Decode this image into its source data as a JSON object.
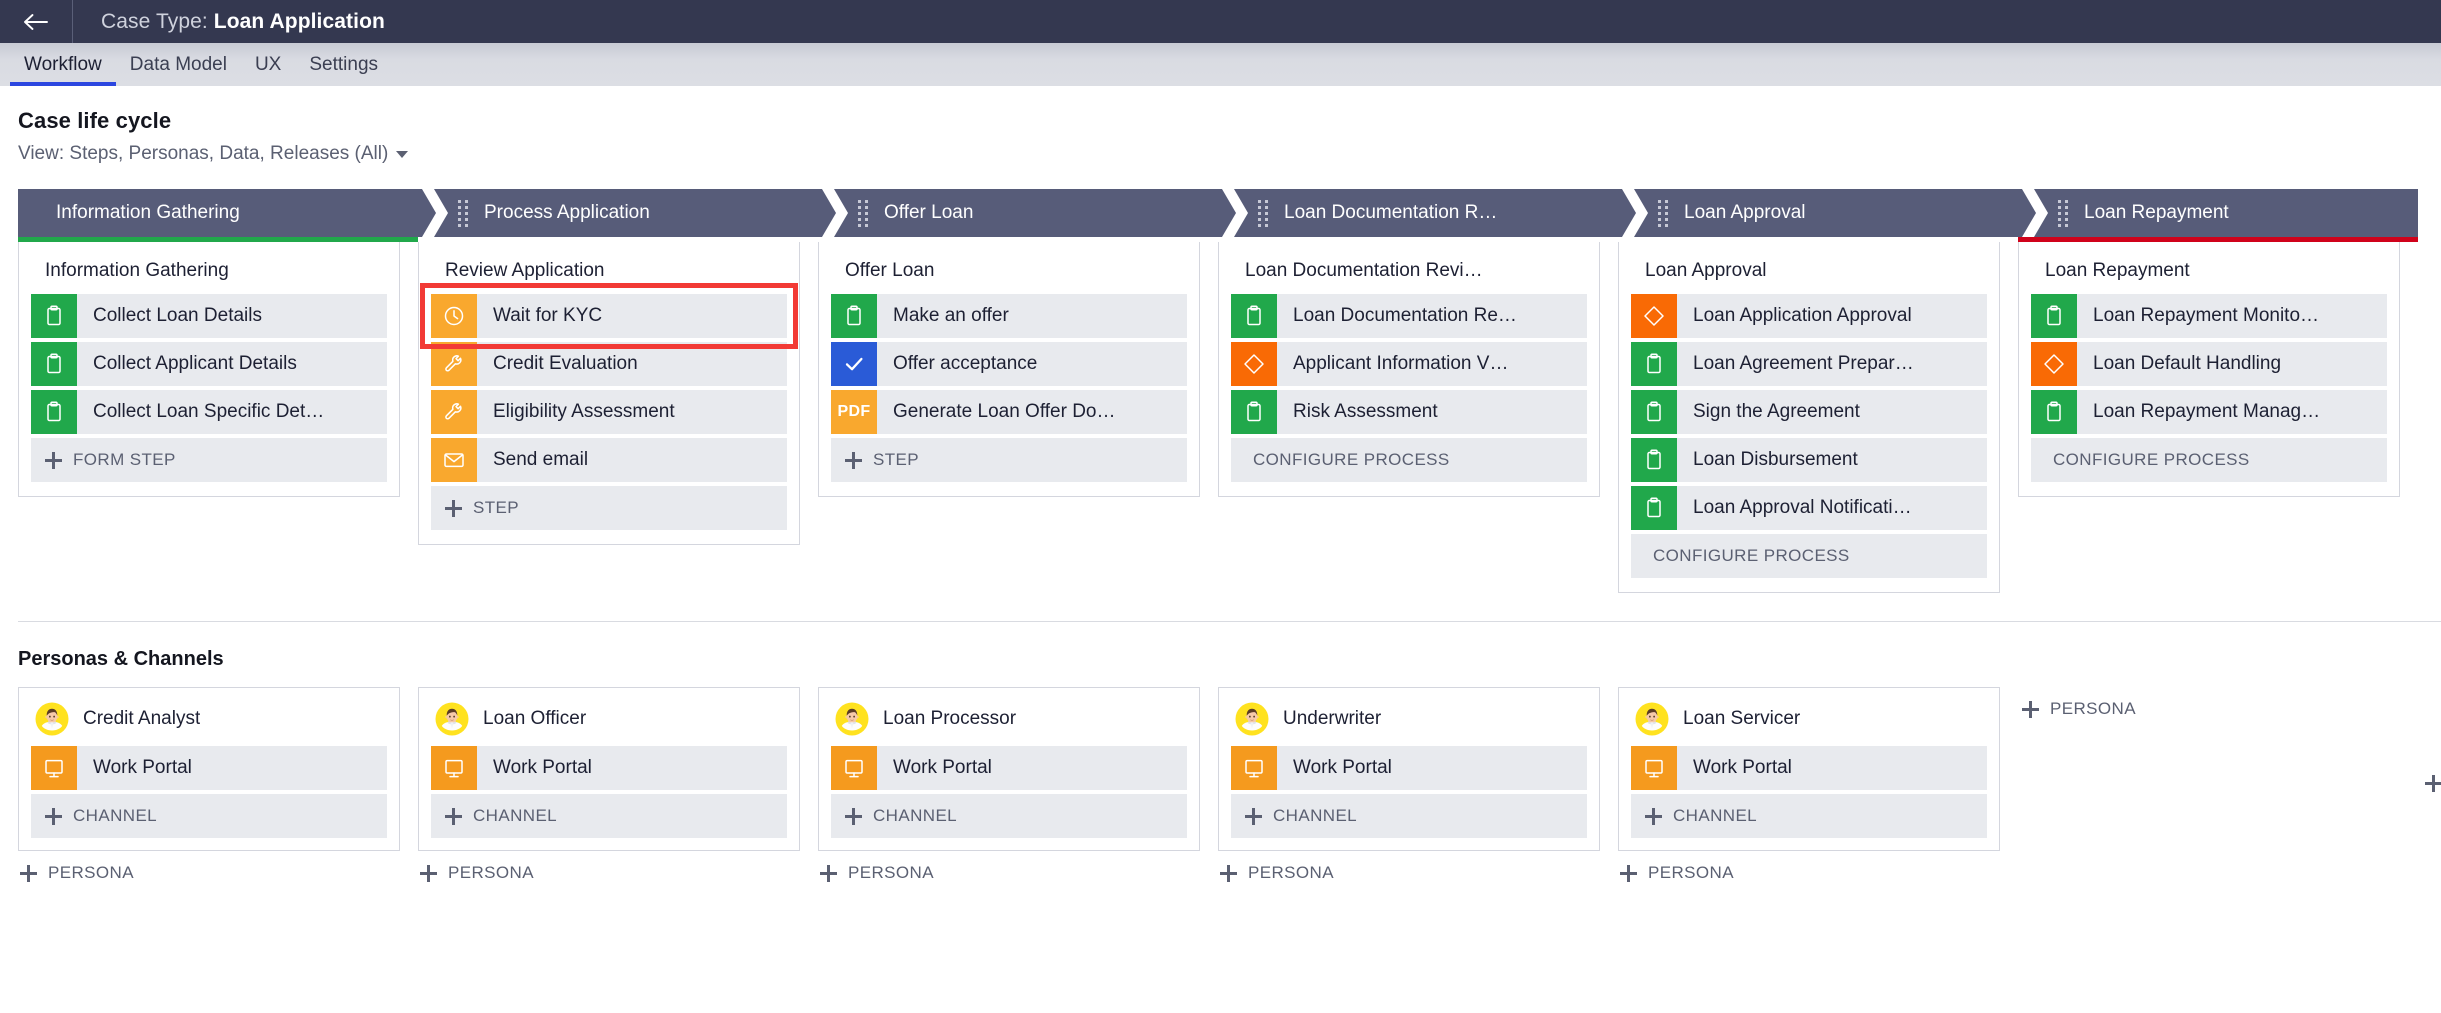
{
  "topbar": {
    "back_icon": "arrow-left-icon",
    "prefix": "Case Type: ",
    "case_type": "Loan Application"
  },
  "tabs": [
    {
      "label": "Workflow",
      "active": true
    },
    {
      "label": "Data Model",
      "active": false
    },
    {
      "label": "UX",
      "active": false
    },
    {
      "label": "Settings",
      "active": false
    }
  ],
  "lifecycle": {
    "title": "Case life cycle",
    "view_label": "View: Steps, Personas, Data, Releases (All)",
    "stages": [
      {
        "name": "Information Gathering",
        "accent": "green",
        "first": true,
        "process_title": "Information Gathering",
        "steps": [
          {
            "label": "Collect Loan Details",
            "icon": "clipboard-icon",
            "color": "green"
          },
          {
            "label": "Collect Applicant Details",
            "icon": "clipboard-icon",
            "color": "green"
          },
          {
            "label": "Collect Loan Specific Det…",
            "icon": "clipboard-icon",
            "color": "green"
          }
        ],
        "add_label": "FORM STEP",
        "add_has_plus": true
      },
      {
        "name": "Process Application",
        "accent": "none",
        "first": false,
        "process_title": "Review Application",
        "steps": [
          {
            "label": "Wait for KYC",
            "icon": "clock-icon",
            "color": "orange",
            "highlighted": true
          },
          {
            "label": "Credit Evaluation",
            "icon": "wrench-icon",
            "color": "orange"
          },
          {
            "label": "Eligibility Assessment",
            "icon": "wrench-icon",
            "color": "orange"
          },
          {
            "label": "Send email",
            "icon": "envelope-icon",
            "color": "orange"
          }
        ],
        "add_label": "STEP",
        "add_has_plus": true
      },
      {
        "name": "Offer Loan",
        "accent": "none",
        "first": false,
        "process_title": "Offer Loan",
        "steps": [
          {
            "label": "Make an offer",
            "icon": "clipboard-icon",
            "color": "green"
          },
          {
            "label": "Offer acceptance",
            "icon": "check-icon",
            "color": "blue"
          },
          {
            "label": "Generate Loan Offer Do…",
            "icon": "pdf-icon",
            "color": "pdf"
          }
        ],
        "add_label": "STEP",
        "add_has_plus": true
      },
      {
        "name": "Loan Documentation R…",
        "accent": "none",
        "first": false,
        "process_title": "Loan Documentation Revi…",
        "steps": [
          {
            "label": "Loan Documentation Re…",
            "icon": "clipboard-icon",
            "color": "green"
          },
          {
            "label": "Applicant Information V…",
            "icon": "diamond-icon",
            "color": "red"
          },
          {
            "label": "Risk Assessment",
            "icon": "clipboard-icon",
            "color": "green"
          }
        ],
        "add_label": "CONFIGURE PROCESS",
        "add_has_plus": false
      },
      {
        "name": "Loan Approval",
        "accent": "none",
        "first": false,
        "process_title": "Loan Approval",
        "steps": [
          {
            "label": "Loan Application Approval",
            "icon": "diamond-icon",
            "color": "red"
          },
          {
            "label": "Loan Agreement Prepar…",
            "icon": "clipboard-icon",
            "color": "green"
          },
          {
            "label": "Sign the Agreement",
            "icon": "clipboard-icon",
            "color": "green"
          },
          {
            "label": "Loan Disbursement",
            "icon": "clipboard-icon",
            "color": "green"
          },
          {
            "label": "Loan Approval Notificati…",
            "icon": "clipboard-icon",
            "color": "green"
          }
        ],
        "add_label": "CONFIGURE PROCESS",
        "add_has_plus": false
      },
      {
        "name": "Loan Repayment",
        "accent": "red",
        "first": false,
        "process_title": "Loan Repayment",
        "steps": [
          {
            "label": "Loan Repayment Monito…",
            "icon": "clipboard-icon",
            "color": "green"
          },
          {
            "label": "Loan Default Handling",
            "icon": "diamond-icon",
            "color": "red"
          },
          {
            "label": "Loan Repayment Manag…",
            "icon": "clipboard-icon",
            "color": "green"
          }
        ],
        "add_label": "CONFIGURE PROCESS",
        "add_has_plus": false
      }
    ]
  },
  "personas_section": {
    "title": "Personas & Channels",
    "add_persona_label": "PERSONA",
    "add_channel_label": "CHANNEL",
    "personas": [
      {
        "name": "Credit Analyst",
        "avatar": "avatar-icon",
        "channels": [
          {
            "label": "Work Portal",
            "icon": "monitor-icon"
          }
        ]
      },
      {
        "name": "Loan Officer",
        "avatar": "avatar-icon",
        "channels": [
          {
            "label": "Work Portal",
            "icon": "monitor-icon"
          }
        ]
      },
      {
        "name": "Loan Processor",
        "avatar": "avatar-icon",
        "channels": [
          {
            "label": "Work Portal",
            "icon": "monitor-icon"
          }
        ]
      },
      {
        "name": "Underwriter",
        "avatar": "avatar-icon",
        "channels": [
          {
            "label": "Work Portal",
            "icon": "monitor-icon"
          }
        ]
      },
      {
        "name": "Loan Servicer",
        "avatar": "avatar-icon",
        "channels": [
          {
            "label": "Work Portal",
            "icon": "monitor-icon"
          }
        ]
      }
    ]
  },
  "colors": {
    "topbar_bg": "#343850",
    "stage_bg": "#575c79",
    "accent_green": "#21a84b",
    "accent_red": "#d0021b",
    "tab_active": "#2c47e0",
    "step_row_bg": "#e8eaee",
    "icon_green": "#21a84b",
    "icon_orange": "#f9a82e",
    "icon_blue": "#2a5bd7",
    "icon_red_orange": "#f96a05",
    "highlight_border": "#f23a35"
  }
}
